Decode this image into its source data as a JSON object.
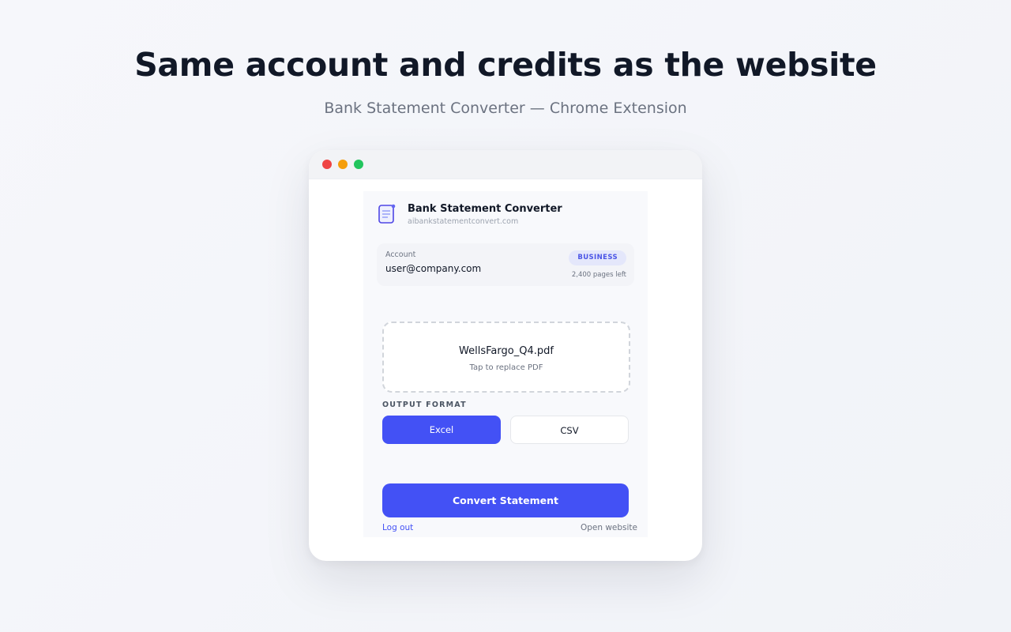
{
  "hero": {
    "headline": "Same account and credits as the website",
    "subheadline": "Bank Statement Converter — Chrome Extension"
  },
  "window": {
    "traffic_lights": [
      "#ef4444",
      "#f59e0b",
      "#22c55e"
    ]
  },
  "popup": {
    "brand": {
      "icon": "document-icon",
      "title": "Bank Statement Converter",
      "domain": "aibankstatementconvert.com"
    },
    "account": {
      "label": "Account",
      "email": "user@company.com",
      "plan": "BUSINESS",
      "pages_left": "2,400 pages left"
    },
    "upload": {
      "filename": "WellsFargo_Q4.pdf",
      "hint": "Tap to replace PDF"
    },
    "output_format": {
      "label": "OUTPUT FORMAT",
      "options": [
        "Excel",
        "CSV"
      ],
      "selected": "Excel"
    },
    "convert_label": "Convert Statement",
    "footer": {
      "logout": "Log out",
      "open_website": "Open website"
    }
  },
  "colors": {
    "accent": "#4351f5",
    "badge_bg": "#e4e7fb",
    "text_dark": "#111827",
    "text_muted": "#6b7280"
  }
}
